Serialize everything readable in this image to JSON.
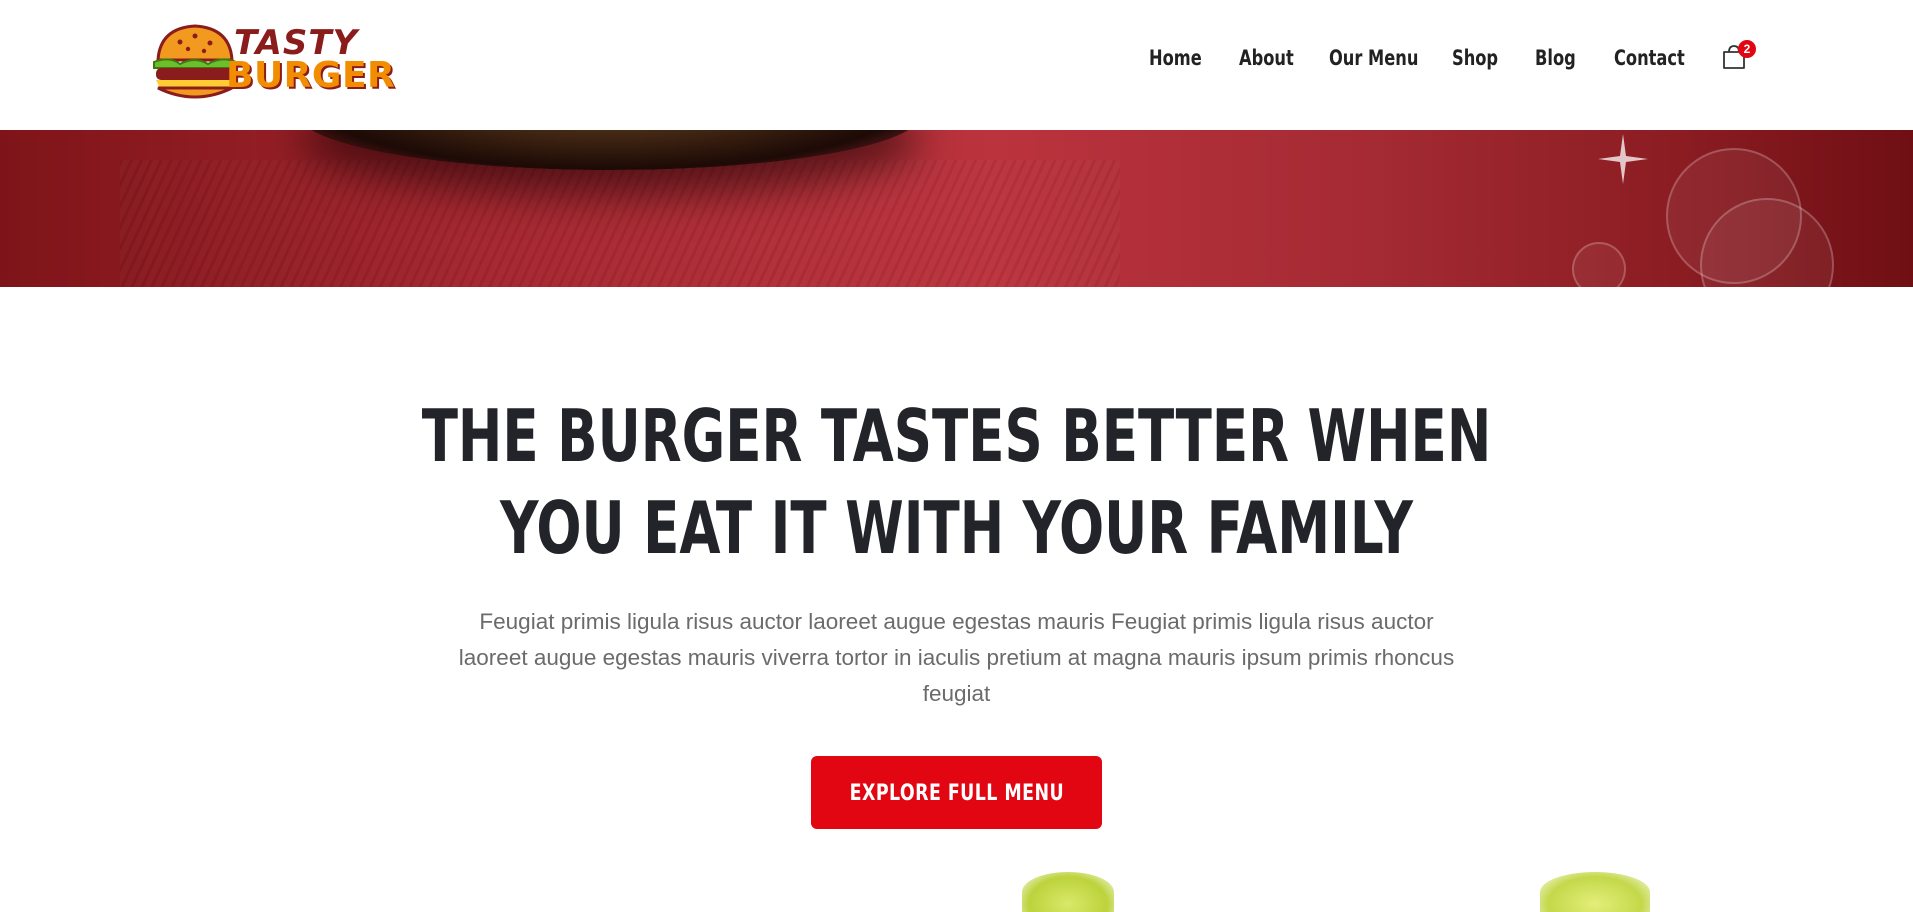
{
  "brand": {
    "logo_line1": "TASTY",
    "logo_line2": "BURGER",
    "colors": {
      "brand_red": "#e20613",
      "logo_dark_red": "#8b1c1c",
      "logo_orange": "#f28c00"
    }
  },
  "nav": {
    "items": [
      {
        "label": "Home"
      },
      {
        "label": "About"
      },
      {
        "label": "Our Menu"
      },
      {
        "label": "Shop"
      },
      {
        "label": "Blog"
      },
      {
        "label": "Contact"
      }
    ],
    "cart": {
      "icon": "shopping-bag-icon",
      "count": "2"
    }
  },
  "main": {
    "headline_line1": "THE BURGER TASTES BETTER WHEN",
    "headline_line2": "YOU EAT IT WITH YOUR FAMILY",
    "description": "Feugiat primis ligula risus auctor laoreet augue egestas mauris Feugiat primis ligula risus auctor laoreet augue egestas mauris viverra tortor in iaculis pretium at magna mauris ipsum primis rhoncus feugiat",
    "cta_label": "EXPLORE FULL MENU"
  }
}
